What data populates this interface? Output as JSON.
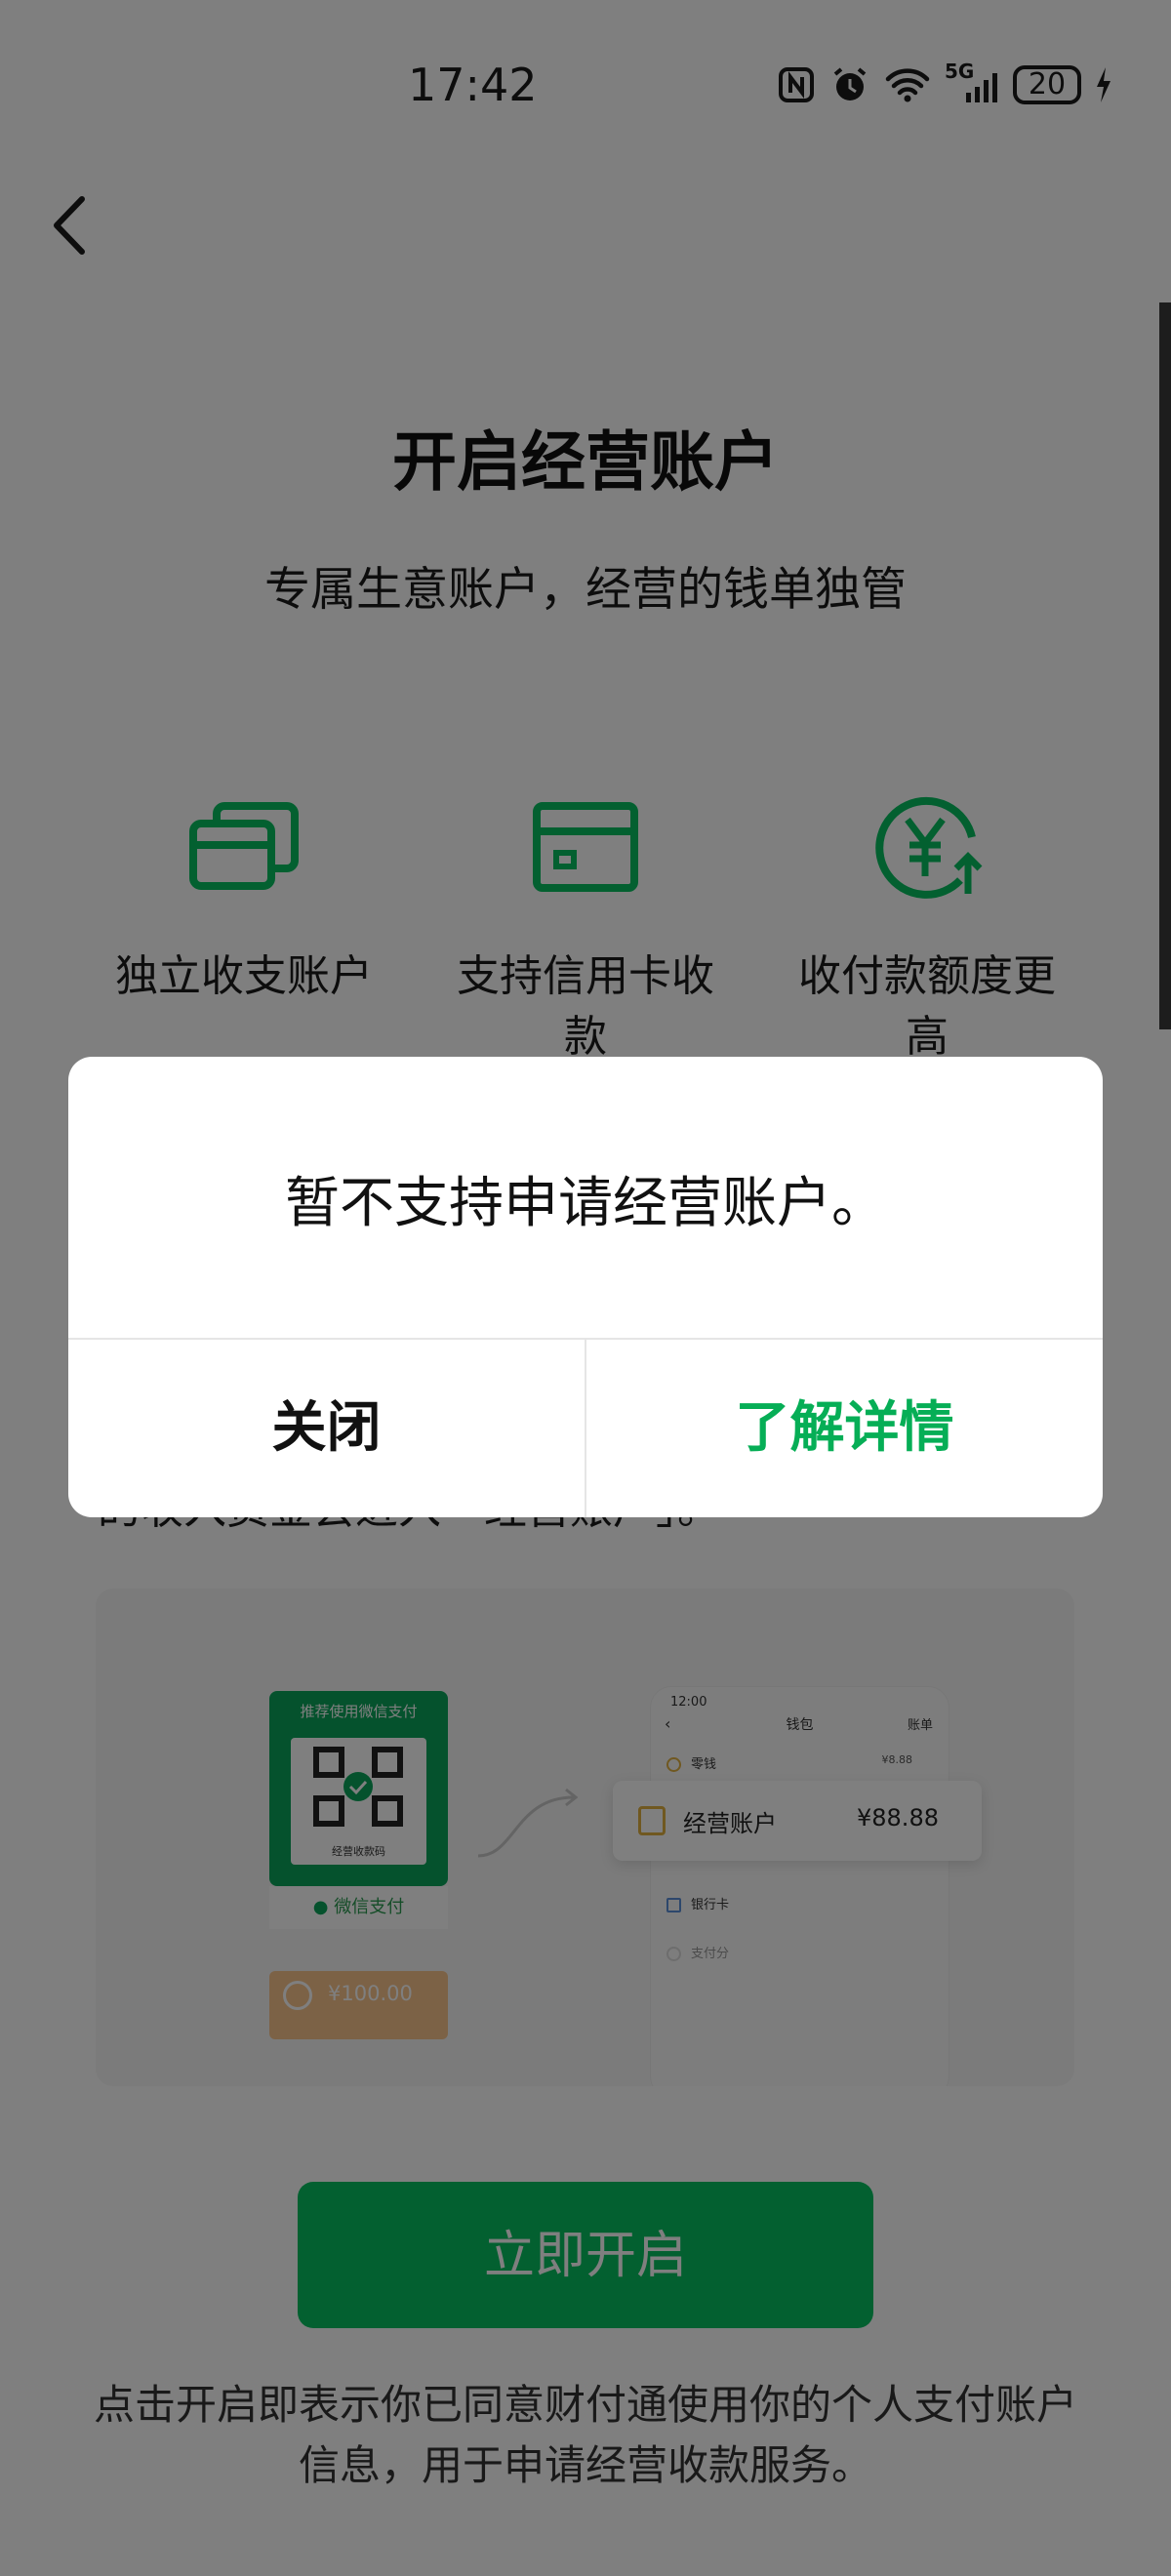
{
  "status_bar": {
    "time": "17:42",
    "network": "5G",
    "battery": "20"
  },
  "header": {
    "title": "开启经营账户",
    "subtitle": "专属生意账户，经营的钱单独管"
  },
  "features": [
    {
      "icon": "cards-icon",
      "label": "独立收支账户"
    },
    {
      "icon": "credit-card-icon",
      "label": "支持信用卡收款"
    },
    {
      "icon": "yuan-up-icon",
      "label": "收付款额度更高"
    }
  ],
  "behind_text": "的收入资金会进入「经营账户」。",
  "illustration": {
    "qr_card_title": "推荐使用微信支付",
    "qr_card_label": "经营收款码",
    "qr_footer": "微信支付",
    "money": "¥100.00",
    "phone": {
      "time": "12:00",
      "title": "钱包",
      "right": "账单",
      "rows": [
        {
          "label": "零钱",
          "value": "¥8.88"
        },
        {
          "label": "银行卡",
          "value": ""
        },
        {
          "label": "支付分",
          "value": ""
        }
      ]
    },
    "account_card": {
      "label": "经营账户",
      "value": "¥88.88"
    }
  },
  "primary_button": "立即开启",
  "agreement": "点击开启即表示你已同意财付通使用你的个人支付账户信息，用于申请经营收款服务。",
  "dialog": {
    "message": "暂不支持申请经营账户。",
    "close_label": "关闭",
    "more_label": "了解详情"
  },
  "colors": {
    "accent": "#07c160",
    "accent_text": "#06ae56",
    "overlay": "rgba(0,0,0,0.5)"
  }
}
